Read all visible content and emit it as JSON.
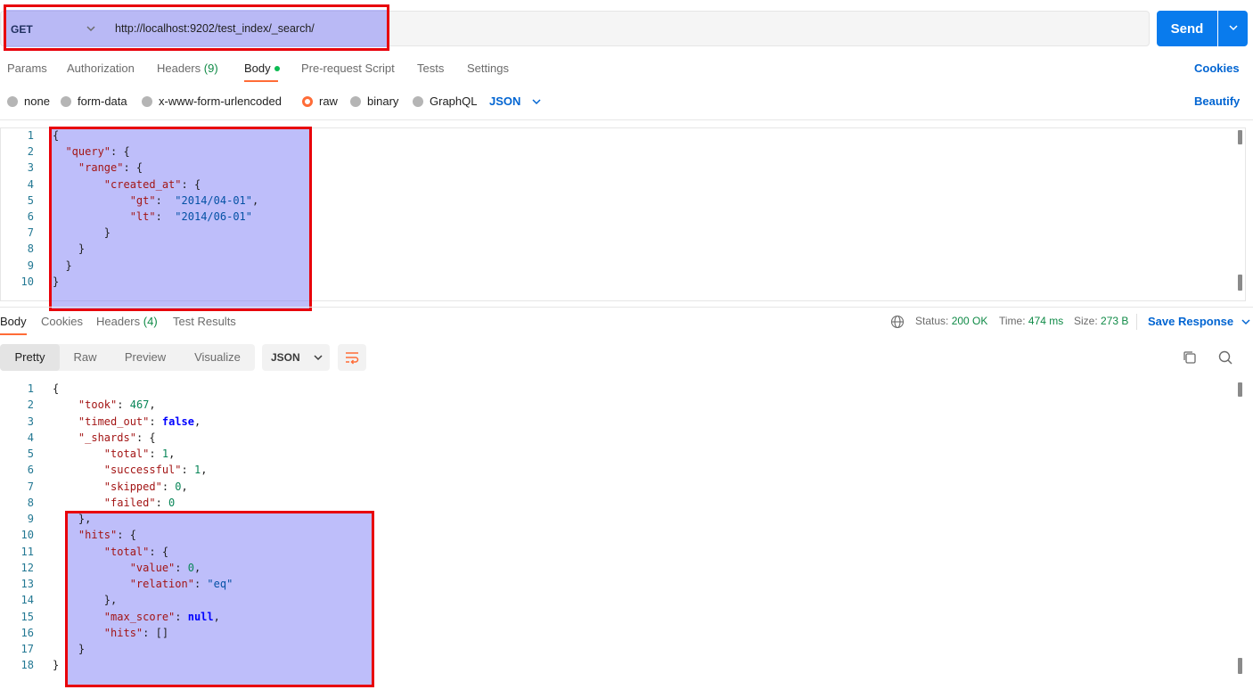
{
  "request": {
    "method": "GET",
    "url": "http://localhost:9202/test_index/_search/",
    "send_label": "Send"
  },
  "request_tabs": {
    "params": "Params",
    "authorization": "Authorization",
    "headers": "Headers",
    "headers_count": "(9)",
    "body": "Body",
    "prerequest": "Pre-request Script",
    "tests": "Tests",
    "settings": "Settings",
    "cookies": "Cookies"
  },
  "body_types": {
    "none": "none",
    "form_data": "form-data",
    "urlencoded": "x-www-form-urlencoded",
    "raw": "raw",
    "binary": "binary",
    "graphql": "GraphQL",
    "format": "JSON",
    "beautify": "Beautify"
  },
  "request_body_lines": [
    [
      [
        "p",
        "{"
      ]
    ],
    [
      [
        "p",
        "  "
      ],
      [
        "k",
        "\"query\""
      ],
      [
        "p",
        ": {"
      ]
    ],
    [
      [
        "p",
        "    "
      ],
      [
        "k",
        "\"range\""
      ],
      [
        "p",
        ": {"
      ]
    ],
    [
      [
        "p",
        "        "
      ],
      [
        "k",
        "\"created_at\""
      ],
      [
        "p",
        ": {"
      ]
    ],
    [
      [
        "p",
        "            "
      ],
      [
        "k",
        "\"gt\""
      ],
      [
        "p",
        ":  "
      ],
      [
        "s",
        "\"2014/04-01\""
      ],
      [
        "p",
        ","
      ]
    ],
    [
      [
        "p",
        "            "
      ],
      [
        "k",
        "\"lt\""
      ],
      [
        "p",
        ":  "
      ],
      [
        "s",
        "\"2014/06-01\""
      ]
    ],
    [
      [
        "p",
        "        }"
      ]
    ],
    [
      [
        "p",
        "    }"
      ]
    ],
    [
      [
        "p",
        "  }"
      ]
    ],
    [
      [
        "p",
        "}"
      ]
    ]
  ],
  "response_tabs": {
    "body": "Body",
    "cookies": "Cookies",
    "headers": "Headers",
    "headers_count": "(4)",
    "test_results": "Test Results"
  },
  "response_meta": {
    "status_label": "Status:",
    "status_value": "200 OK",
    "time_label": "Time:",
    "time_value": "474 ms",
    "size_label": "Size:",
    "size_value": "273 B",
    "save_response": "Save Response"
  },
  "response_view": {
    "pretty": "Pretty",
    "raw": "Raw",
    "preview": "Preview",
    "visualize": "Visualize",
    "format": "JSON"
  },
  "response_body_lines": [
    [
      [
        "p",
        "{"
      ]
    ],
    [
      [
        "p",
        "    "
      ],
      [
        "k",
        "\"took\""
      ],
      [
        "p",
        ": "
      ],
      [
        "n",
        "467"
      ],
      [
        "p",
        ","
      ]
    ],
    [
      [
        "p",
        "    "
      ],
      [
        "k",
        "\"timed_out\""
      ],
      [
        "p",
        ": "
      ],
      [
        "b",
        "false"
      ],
      [
        "p",
        ","
      ]
    ],
    [
      [
        "p",
        "    "
      ],
      [
        "k",
        "\"_shards\""
      ],
      [
        "p",
        ": {"
      ]
    ],
    [
      [
        "p",
        "        "
      ],
      [
        "k",
        "\"total\""
      ],
      [
        "p",
        ": "
      ],
      [
        "n",
        "1"
      ],
      [
        "p",
        ","
      ]
    ],
    [
      [
        "p",
        "        "
      ],
      [
        "k",
        "\"successful\""
      ],
      [
        "p",
        ": "
      ],
      [
        "n",
        "1"
      ],
      [
        "p",
        ","
      ]
    ],
    [
      [
        "p",
        "        "
      ],
      [
        "k",
        "\"skipped\""
      ],
      [
        "p",
        ": "
      ],
      [
        "n",
        "0"
      ],
      [
        "p",
        ","
      ]
    ],
    [
      [
        "p",
        "        "
      ],
      [
        "k",
        "\"failed\""
      ],
      [
        "p",
        ": "
      ],
      [
        "n",
        "0"
      ]
    ],
    [
      [
        "p",
        "    },"
      ]
    ],
    [
      [
        "p",
        "    "
      ],
      [
        "k",
        "\"hits\""
      ],
      [
        "p",
        ": {"
      ]
    ],
    [
      [
        "p",
        "        "
      ],
      [
        "k",
        "\"total\""
      ],
      [
        "p",
        ": {"
      ]
    ],
    [
      [
        "p",
        "            "
      ],
      [
        "k",
        "\"value\""
      ],
      [
        "p",
        ": "
      ],
      [
        "n",
        "0"
      ],
      [
        "p",
        ","
      ]
    ],
    [
      [
        "p",
        "            "
      ],
      [
        "k",
        "\"relation\""
      ],
      [
        "p",
        ": "
      ],
      [
        "s",
        "\"eq\""
      ]
    ],
    [
      [
        "p",
        "        },"
      ]
    ],
    [
      [
        "p",
        "        "
      ],
      [
        "k",
        "\"max_score\""
      ],
      [
        "p",
        ": "
      ],
      [
        "b",
        "null"
      ],
      [
        "p",
        ","
      ]
    ],
    [
      [
        "p",
        "        "
      ],
      [
        "k",
        "\"hits\""
      ],
      [
        "p",
        ": []"
      ]
    ],
    [
      [
        "p",
        "    }"
      ]
    ],
    [
      [
        "p",
        "}"
      ]
    ]
  ],
  "colors": {
    "accent": "#ff6c37",
    "send_button": "#097bed",
    "link": "#0265d2",
    "selection_highlight": "#7878f5",
    "annotation_box": "#e8000a",
    "status_ok": "#0f8a46"
  },
  "icons": [
    "chevron-down-icon",
    "globe-icon",
    "copy-icon",
    "search-icon",
    "wrap-lines-icon"
  ]
}
